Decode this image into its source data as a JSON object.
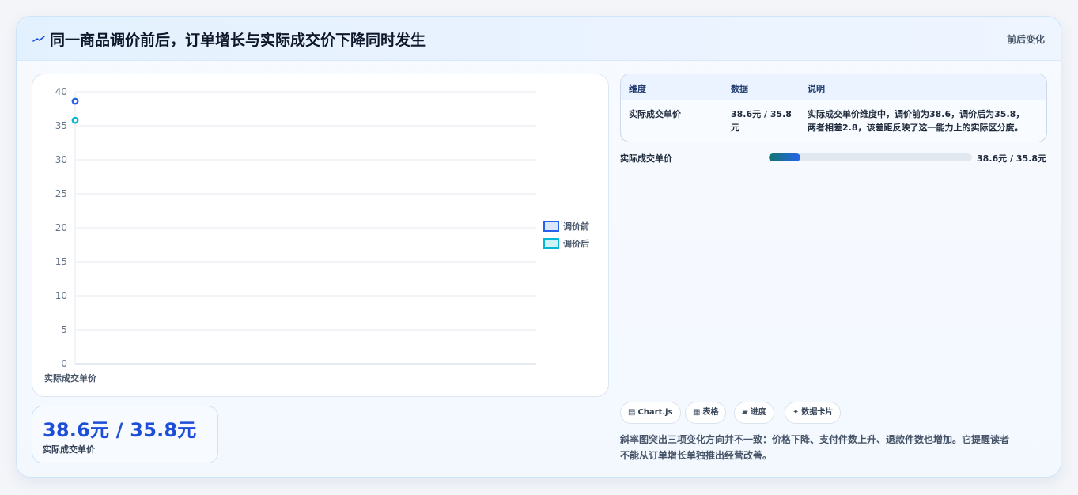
{
  "header": {
    "title": "同一商品调价前后，订单增长与实际成交价下降同时发生",
    "tag": "前后变化",
    "icon": "trend-line-icon"
  },
  "chart_data": {
    "type": "scatter",
    "categories": [
      "实际成交单价"
    ],
    "series": [
      {
        "name": "调价前",
        "values": [
          38.6
        ],
        "color": "#2563eb"
      },
      {
        "name": "调价后",
        "values": [
          35.8
        ],
        "color": "#06b6d4"
      }
    ],
    "ylim": [
      0,
      40
    ],
    "yticks": [
      0,
      5,
      10,
      15,
      20,
      25,
      30,
      35,
      40
    ],
    "grid": true,
    "legend": "right"
  },
  "kpi": {
    "value": "38.6元 / 35.8元",
    "label": "实际成交单价"
  },
  "table": {
    "headers": [
      "维度",
      "数据",
      "说明"
    ],
    "rows": [
      {
        "dimension": "实际成交单价",
        "data_line1": "38.6元 / 35.8",
        "data_line2": "元",
        "note_line1": "实际成交单价维度中，调价前为38.6，调价后为35.8，",
        "note_line2": "两者相差2.8，该差距反映了这一能力上的实际区分度。"
      }
    ]
  },
  "progress": {
    "label": "实际成交单价",
    "value_text": "38.6元 / 35.8元",
    "fraction": 0.155
  },
  "chips": [
    {
      "icon": "chart-icon",
      "glyph": "▤",
      "label": "Chart.js"
    },
    {
      "icon": "table-icon",
      "glyph": "▦",
      "label": "表格"
    },
    {
      "icon": "progress-icon",
      "glyph": "▰",
      "label": "进度"
    },
    {
      "icon": "sparkle-icon",
      "glyph": "✦",
      "label": "数据卡片"
    }
  ],
  "description": {
    "line1": "斜率图突出三项变化方向并不一致：价格下降、支付件数上升、退款件数也增加。它提醒读者",
    "line2": "不能从订单增长单独推出经营改善。"
  }
}
